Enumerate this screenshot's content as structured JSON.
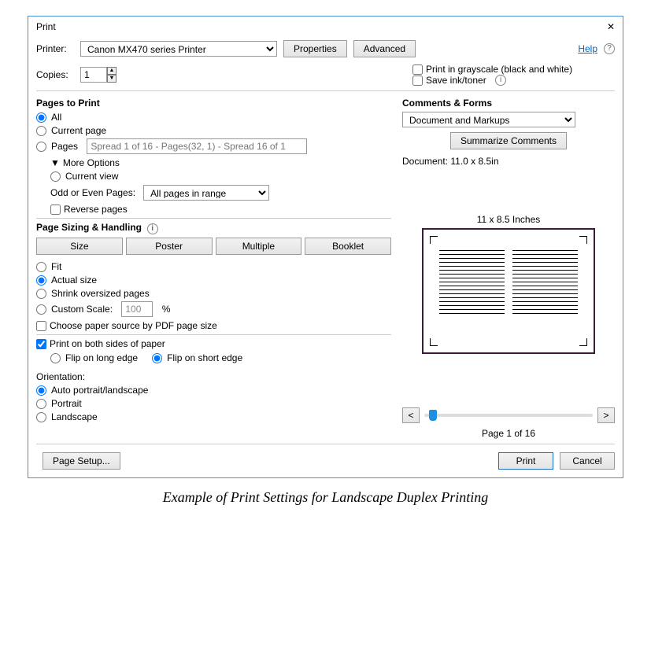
{
  "window": {
    "title": "Print",
    "close": "✕"
  },
  "top": {
    "printer_label": "Printer:",
    "printer_selected": "Canon MX470 series Printer",
    "properties_btn": "Properties",
    "advanced_btn": "Advanced",
    "help": "Help"
  },
  "copies": {
    "label": "Copies:",
    "value": "1"
  },
  "checks": {
    "grayscale": "Print in grayscale (black and white)",
    "saveink": "Save ink/toner"
  },
  "pages": {
    "title": "Pages to Print",
    "all": "All",
    "current": "Current page",
    "pages_label": "Pages",
    "range_placeholder": "Spread 1 of 16 - Pages(32, 1) - Spread 16 of 1",
    "more": "More Options",
    "current_view": "Current view",
    "odd_even_label": "Odd or Even Pages:",
    "odd_even_value": "All pages in range",
    "reverse": "Reverse pages"
  },
  "sizing": {
    "title": "Page Sizing & Handling",
    "size": "Size",
    "poster": "Poster",
    "multiple": "Multiple",
    "booklet": "Booklet",
    "fit": "Fit",
    "actual": "Actual size",
    "shrink": "Shrink oversized pages",
    "custom": "Custom Scale:",
    "custom_val": "100",
    "pct": "%",
    "choose_source": "Choose paper source by PDF page size"
  },
  "duplex": {
    "both": "Print on both sides of paper",
    "long": "Flip on long edge",
    "short": "Flip on short edge"
  },
  "orient": {
    "title": "Orientation:",
    "auto": "Auto portrait/landscape",
    "portrait": "Portrait",
    "landscape": "Landscape"
  },
  "cf": {
    "title": "Comments & Forms",
    "selected": "Document and Markups",
    "summarize": "Summarize Comments"
  },
  "preview": {
    "doc": "Document: 11.0 x 8.5in",
    "dims": "11 x 8.5 Inches",
    "prev": "<",
    "next": ">",
    "page_of": "Page 1 of 16"
  },
  "footer": {
    "page_setup": "Page Setup...",
    "print": "Print",
    "cancel": "Cancel"
  },
  "caption": "Example of Print Settings for Landscape Duplex Printing"
}
